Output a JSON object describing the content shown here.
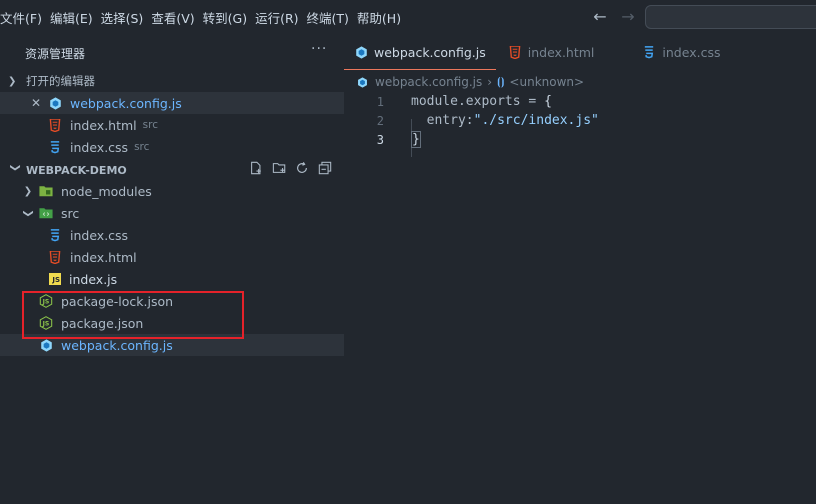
{
  "menu": [
    "文件(F)",
    "编辑(E)",
    "选择(S)",
    "查看(V)",
    "转到(G)",
    "运行(R)",
    "终端(T)",
    "帮助(H)"
  ],
  "nav": {
    "back_icon": "arrow-left-icon",
    "forward_icon": "arrow-right-icon"
  },
  "sidebar": {
    "title": "资源管理器",
    "more": "···",
    "open_editors": {
      "title": "打开的编辑器",
      "items": [
        {
          "name": "webpack.config.js",
          "desc": "",
          "icon": "webpack-icon"
        },
        {
          "name": "index.html",
          "desc": "src",
          "icon": "html-icon"
        },
        {
          "name": "index.css",
          "desc": "src",
          "icon": "css-icon"
        }
      ]
    },
    "project": {
      "title": "WEBPACK-DEMO",
      "items": [
        {
          "name": "node_modules",
          "type": "folder",
          "icon": "folder-node-icon"
        },
        {
          "name": "src",
          "type": "folder",
          "icon": "folder-src-icon"
        },
        {
          "name": "index.css",
          "icon": "css-icon"
        },
        {
          "name": "index.html",
          "icon": "html-icon"
        },
        {
          "name": "index.js",
          "icon": "js-icon"
        },
        {
          "name": "package-lock.json",
          "icon": "json-icon"
        },
        {
          "name": "package.json",
          "icon": "json-icon"
        },
        {
          "name": "webpack.config.js",
          "icon": "webpack-icon"
        }
      ]
    }
  },
  "editor": {
    "tabs": [
      {
        "label": "webpack.config.js",
        "active": true
      },
      {
        "label": "index.html",
        "active": false
      },
      {
        "label": "index.css",
        "active": false
      }
    ],
    "breadcrumb": {
      "file": "webpack.config.js",
      "symbol": "<unknown>"
    },
    "lines": {
      "n1": "1",
      "n2": "2",
      "n3": "3",
      "l1a": "module.exports = ",
      "l1b": "{",
      "l2a": "  entry:",
      "l2b": "\"./src/index.js\"",
      "l3": "}"
    }
  },
  "colors": {
    "accent": "#ec775c",
    "highlight_box": "#e5222a"
  }
}
